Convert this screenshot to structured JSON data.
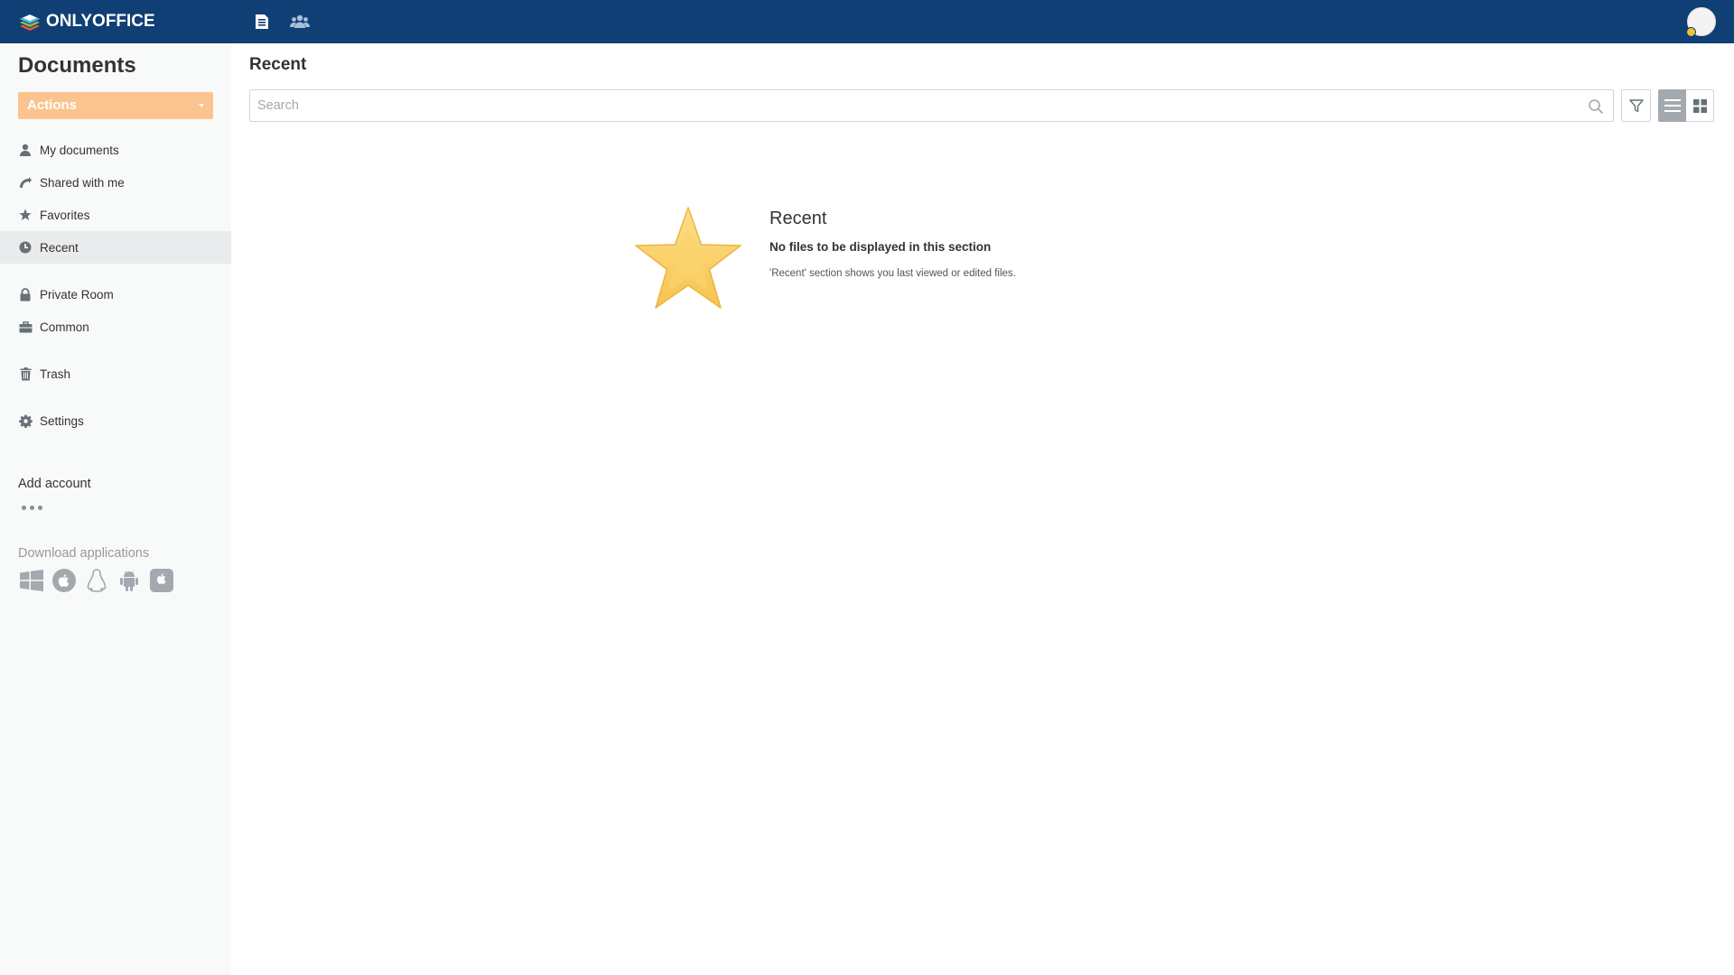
{
  "header": {
    "brand": "ONLYOFFICE",
    "icons": [
      "documents-icon",
      "people-icon"
    ],
    "colors": {
      "background": "#0f3f74",
      "badge": "#f2c230"
    }
  },
  "sidebar": {
    "title": "Documents",
    "actions_label": "Actions",
    "items": [
      {
        "label": "My documents",
        "icon": "person-icon"
      },
      {
        "label": "Shared with me",
        "icon": "share-icon"
      },
      {
        "label": "Favorites",
        "icon": "star-icon"
      },
      {
        "label": "Recent",
        "icon": "clock-icon",
        "active": true
      },
      {
        "label": "Private Room",
        "icon": "lock-icon"
      },
      {
        "label": "Common",
        "icon": "briefcase-icon"
      },
      {
        "label": "Trash",
        "icon": "trash-icon"
      },
      {
        "label": "Settings",
        "icon": "gear-icon"
      }
    ],
    "add_account": "Add account",
    "download_title": "Download applications",
    "apps": [
      "windows-icon",
      "macos-icon",
      "linux-icon",
      "android-icon",
      "ios-icon"
    ],
    "colors": {
      "actions_button": "#fbc48e"
    }
  },
  "main": {
    "title": "Recent",
    "search": {
      "placeholder": "Search",
      "value": ""
    },
    "empty_state": {
      "title": "Recent",
      "subtitle": "No files to be displayed in this section",
      "description": "'Recent' section shows you last viewed or edited files."
    }
  }
}
